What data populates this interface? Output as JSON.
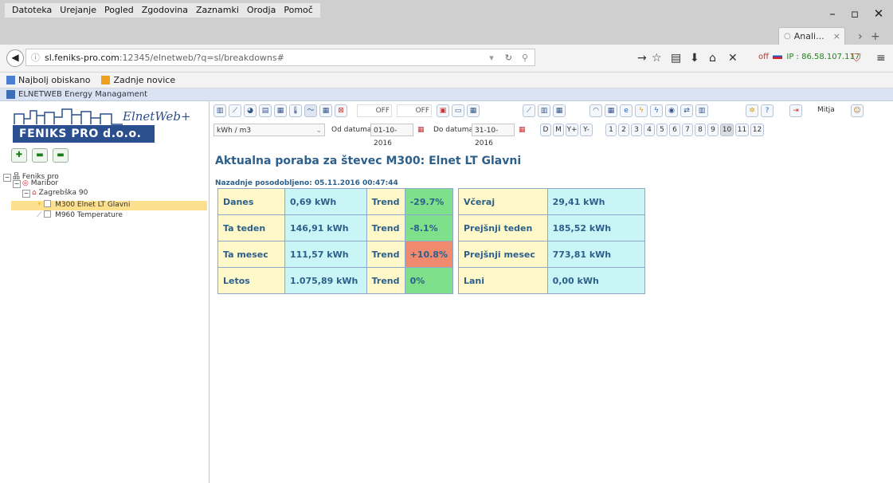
{
  "menu": [
    "Datoteka",
    "Urejanje",
    "Pogled",
    "Zgodovina",
    "Zaznamki",
    "Orodja",
    "Pomoč"
  ],
  "tab": {
    "label": "Anali...",
    "close": "×"
  },
  "address": {
    "host": "sl.feniks-pro.com",
    "rest": ":12345/elnetweb/?q=sl/breakdowns#"
  },
  "status": {
    "off": "off",
    "ip": "IP : 86.58.107.117"
  },
  "bookmarks": [
    "Najbolj obiskano",
    "Zadnje novice"
  ],
  "app_title": "ELNETWEB Energy Managament",
  "logo": {
    "company": "FENIKS PRO d.o.o.",
    "product": "ElnetWeb+"
  },
  "tree": {
    "root": "Feniks pro",
    "city": "Maribor",
    "building": "Zagrebška 90",
    "meters": [
      "M300 Elnet LT Glavni",
      "M960 Temperature"
    ]
  },
  "toolbar": {
    "off1": "OFF",
    "off2": "OFF",
    "user": "Mitja"
  },
  "controls": {
    "unit": "kWh / m3",
    "from_label": "Od datuma",
    "from_value": "01-10-2016",
    "to_label": "Do datuma",
    "to_value": "31-10-2016",
    "period_buttons": [
      "D",
      "M",
      "Y+",
      "Y-"
    ],
    "months": [
      "1",
      "2",
      "3",
      "4",
      "5",
      "6",
      "7",
      "8",
      "9",
      "10",
      "11",
      "12"
    ]
  },
  "main": {
    "heading": "Aktualna poraba za števec M300: Elnet LT Glavni",
    "updated": "Nazadnje posodobljeno: 05.11.2016 00:47:44",
    "rows": [
      {
        "label": "Danes",
        "value": "0,69 kWh",
        "trend_label": "Trend",
        "trend": "-29.7%",
        "trend_color": "#7ee08a",
        "prev_label": "Včeraj",
        "prev_value": "29,41 kWh"
      },
      {
        "label": "Ta teden",
        "value": "146,91 kWh",
        "trend_label": "Trend",
        "trend": "-8.1%",
        "trend_color": "#7ee08a",
        "prev_label": "Prejšnji teden",
        "prev_value": "185,52 kWh"
      },
      {
        "label": "Ta mesec",
        "value": "111,57 kWh",
        "trend_label": "Trend",
        "trend": "+10.8%",
        "trend_color": "#f08a6e",
        "prev_label": "Prejšnji mesec",
        "prev_value": "773,81 kWh"
      },
      {
        "label": "Letos",
        "value": "1.075,89 kWh",
        "trend_label": "Trend",
        "trend": "0%",
        "trend_color": "#7ee08a",
        "prev_label": "Lani",
        "prev_value": "0,00 kWh"
      }
    ]
  }
}
